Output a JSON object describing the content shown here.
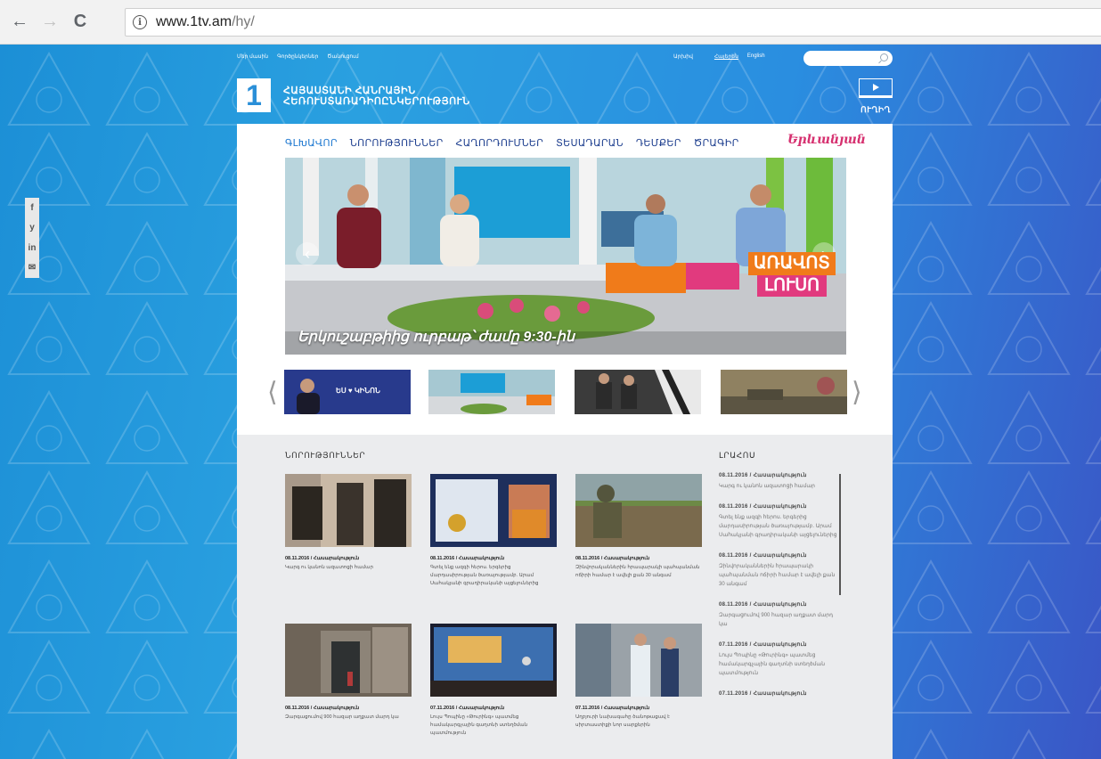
{
  "browser": {
    "back": "←",
    "forward": "→",
    "reload": "C",
    "info": "i",
    "url_host": "www.1tv.am",
    "url_path": "/hy/"
  },
  "social": [
    "f",
    "y",
    "in",
    "✉"
  ],
  "topbar": {
    "links": [
      "Մեր մասին",
      "Գործընկերներ",
      "Ծանուցում"
    ],
    "archive": "Արխիվ",
    "lang_hy": "Հայերեն",
    "lang_en": "English"
  },
  "logo": {
    "digit": "1",
    "line1": "ՀԱՅԱՍՏԱՆԻ ՀԱՆՐԱՅԻՆ",
    "line2": "ՀԵՌՈՒՍՏԱՌԱԴԻՈԸՆԿԵՐՈՒԹՅՈՒՆ",
    "live": "ՈՒՂԻՂ"
  },
  "menu": [
    "ԳԼԽԱՎՈՐ",
    "ՆՈՐՈՒԹՅՈՒՆՆԵՐ",
    "ՀԱՂՈՐԴՈՒՄՆԵՐ",
    "ՏԵՍԱԴԱՐԱՆ",
    "ԴԵՄՔԵՐ",
    "ԾՐԱԳԻՐ"
  ],
  "brand": "Երևանյան",
  "hero": {
    "caption": "Երկուշաբթիից ուրբաթ՝ ժամը 9:30-ին",
    "show_line1": "ԱՌԱՎՈՏ",
    "show_line2": "ԼՈՒՍՈ"
  },
  "thumbs": [
    {
      "label": "ԵՍ ♥ ԿԻՆՈՆ",
      "color": "#2d3f8f"
    },
    {
      "label": "",
      "color": "#5fa8c8"
    },
    {
      "label": "",
      "color": "#444"
    },
    {
      "label": "",
      "color": "#7a6b4e"
    }
  ],
  "news": {
    "title": "ՆՈՐՈՒԹՅՈՒՆՆԵՐ",
    "items": [
      {
        "date": "08.11.2016 / Հասարակություն",
        "text": "Կարգ ու կանոն ազատոցի համար"
      },
      {
        "date": "08.11.2016 / Հասարակություն",
        "text": "Գտել ենք ազգի հերոս. երգերից մարդասիրության ծառայությամբ. Արամ Սահակյանի գրադիրականի այցելուներից"
      },
      {
        "date": "08.11.2016 / Հասարակություն",
        "text": "Զինվորականներին հրապարակի պահպանման ոճիրի համար է ավելի քան 30 անգամ"
      },
      {
        "date": "08.11.2016 / Հասարակություն",
        "text": "Զարգացումով 900 հազար աղքատ մարդ կա"
      },
      {
        "date": "07.11.2016 / Հասարակություն",
        "text": "Լույս Պոպինը «Թուրինգ» պատմեց համակարգչային գաղտնի ստեղծման պատմություն"
      },
      {
        "date": "07.11.2016 / Հասարակություն",
        "text": "Աղբյուրի նախագահը ծանոթացավ է սիրտաստիքի նոր սարքերին"
      }
    ]
  },
  "feed": {
    "title": "ԼՐԱՀՈՍ",
    "items": [
      {
        "date": "08.11.2016 / Հասարակություն",
        "text": "Կարգ ու կանոն ազատոցի համար"
      },
      {
        "date": "08.11.2016 / Հասարակություն",
        "text": "Գտել ենք ազգի հերոս. երգերից մարդասիրության ծառայությամբ. Արամ Սահակյանի գրադիրականի այցելուներից"
      },
      {
        "date": "08.11.2016 / Հասարակություն",
        "text": "Զինվորականներին հրապարակի պահպանման ոճիրի համար է ավելի քան 30 անգամ"
      },
      {
        "date": "08.11.2016 / Հասարակություն",
        "text": "Զարգացումով 900 հազար աղքատ մարդ կա"
      },
      {
        "date": "07.11.2016 / Հասարակություն",
        "text": "Լույս Պոպինը «Թուրինգ» պատմեց համակարգչային գաղտնի ստեղծման պատմություն"
      },
      {
        "date": "07.11.2016 / Հասարակություն",
        "text": ""
      }
    ]
  },
  "colors": {
    "accent": "#1e78d0",
    "brand_pink": "#d6306f",
    "show_orange": "#f07b1a"
  }
}
